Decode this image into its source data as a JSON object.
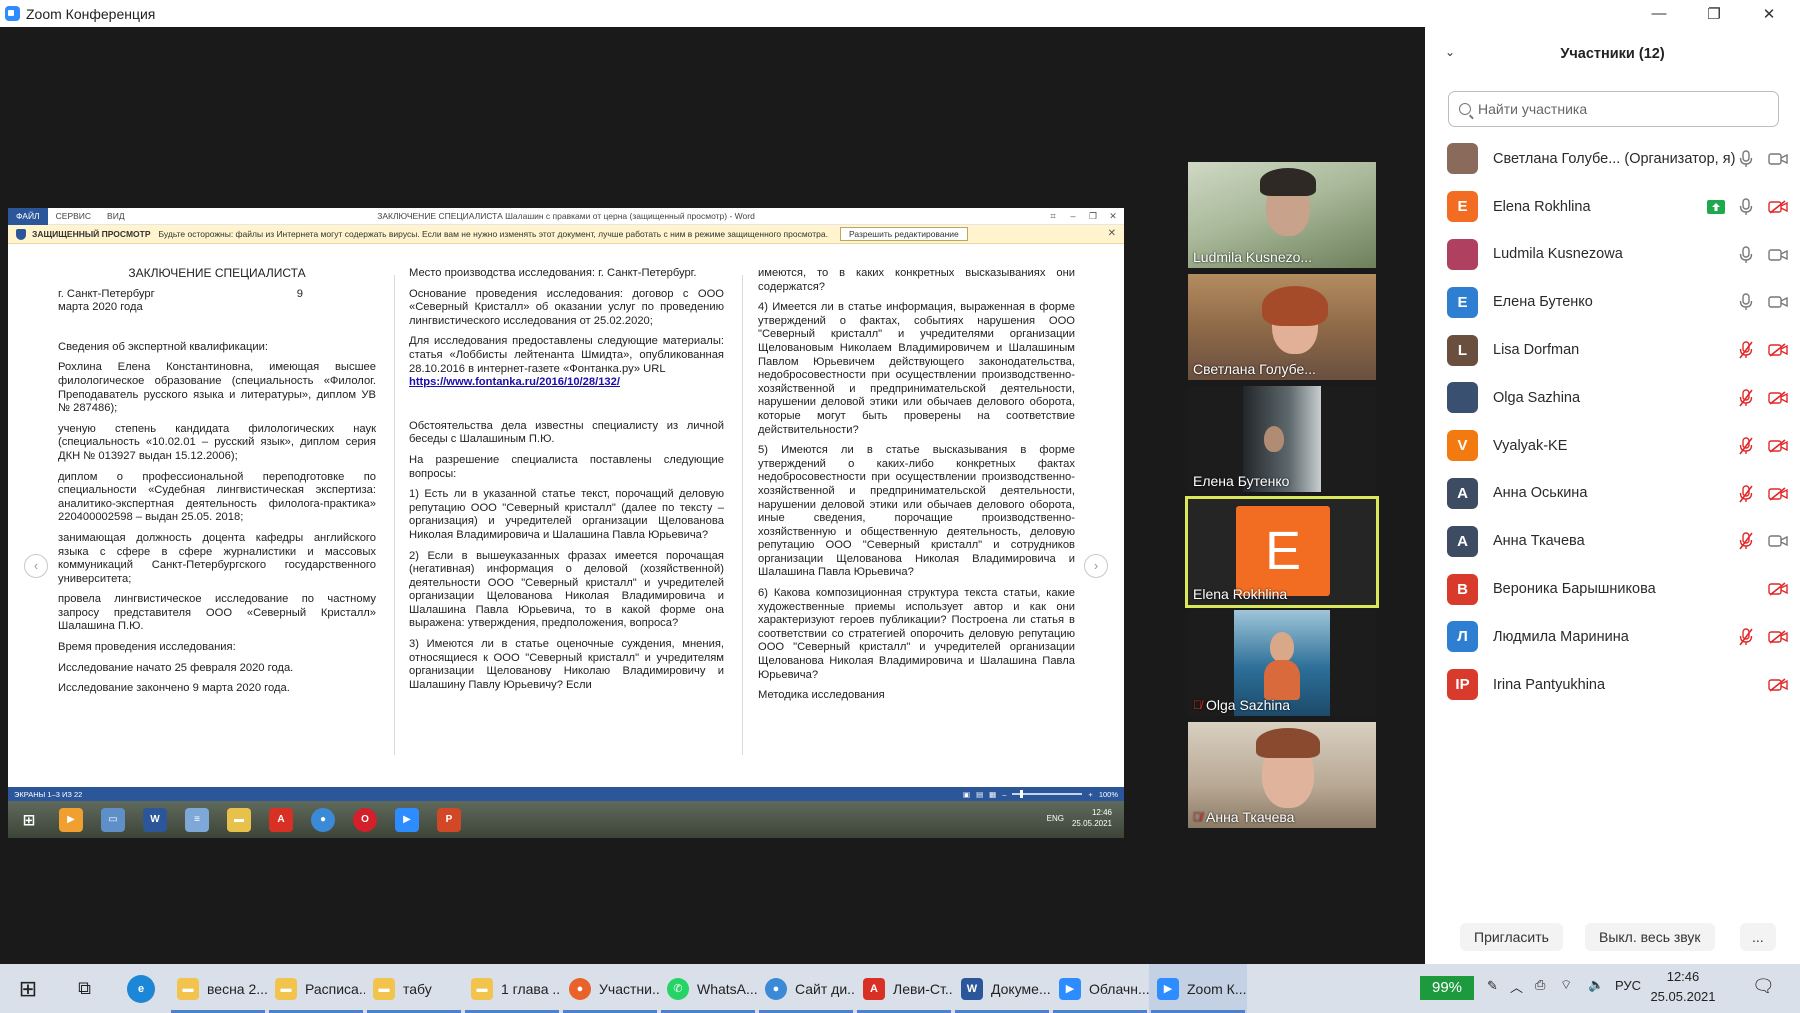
{
  "window": {
    "title": "Zoom Конференция",
    "min": "—",
    "max": "❐",
    "close": "✕"
  },
  "word": {
    "menu": [
      "ФАЙЛ",
      "СЕРВИС",
      "ВИД"
    ],
    "title": "ЗАКЛЮЧЕНИЕ СПЕЦИАЛИСТА Шалашин с правками от церна (защищенный просмотр) - Word",
    "protected_title": "ЗАЩИЩЕННЫЙ ПРОСМОТР",
    "protected_text": "Будьте осторожны: файлы из Интернета могут содержать вирусы. Если вам не нужно изменять этот документ, лучше работать с ним в режиме защищенного просмотра.",
    "enable_button": "Разрешить редактирование",
    "status_left": "ЭКРАНЫ 1–3 ИЗ 22",
    "zoom": "100%",
    "tray_lang": "ENG",
    "tray_time": "12:46",
    "tray_date": "25.05.2021"
  },
  "document": {
    "heading": "ЗАКЛЮЧЕНИЕ СПЕЦИАЛИСТА",
    "city": "г. Санкт-Петербург",
    "date_num": "9",
    "date_rest": "марта 2020 года",
    "col1": [
      "Сведения об экспертной квалификации:",
      "Рохлина Елена Константиновна, имеющая высшее филологическое образование (специальность «Филолог. Преподаватель русского языка и литературы», диплом УВ № 287486);",
      "ученую степень кандидата филологических наук (специальность «10.02.01 – русский язык», диплом серия ДКН № 013927 выдан 15.12.2006);",
      "диплом о профессиональной переподготовке по специальности «Судебная лингвистическая экспертиза: аналитико-экспертная деятельность филолога-практика» 220400002598 – выдан 25.05. 2018;",
      "занимающая должность доцента кафедры английского языка с сфере в сфере журналистики и массовых коммуникаций Санкт-Петербургского государственного университета;",
      "провелa лингвистическое исследование по частному запросу представителя ООО «Северный Кристалл» Шалашина П.Ю.",
      "Время проведения исследования:",
      "Исследование начато 25 февраля 2020 года.",
      "Исследование закончено 9 марта 2020 года."
    ],
    "col2_a": [
      "Место производства исследования: г. Санкт-Петербург.",
      "Основание проведения исследования: договор с ООО «Северный Кристалл» об оказании услуг по проведению лингвистического исследования от 25.02.2020;",
      "Для исследования предоставлены следующие материалы: статья «Лоббисты лейтенанта Шмидта», опубликованная 28.10.2016 в интернет-газете «Фонтанка.ру» URL"
    ],
    "link": "https://www.fontanka.ru/2016/10/28/132/",
    "col2_b": [
      "Обстоятельства дела известны специалисту из личной беседы с Шалашиным П.Ю.",
      "На разрешение специалиста поставлены следующие вопросы:",
      "1) Есть ли в указанной статье текст, порочащий деловую репутацию ООО \"Северный кристалл\" (далее по тексту – организация) и учредителей организации Щеловановa Николая Владимировича и Шалашина Павла Юрьевича?",
      "2) Если в вышеуказанных фразах имеется порочащая (негативная) информация о деловой (хозяйственной) деятельности ООО \"Северный кристалл\" и учредителей организации Щелованова Николая Владимировича и Шалашина Павла Юрьевича, то в какой форме она выражена: утверждения, предположения, вопроса?",
      "3) Имеются ли в статье оценочные суждения, мнения, относящиеся к ООО \"Северный кристалл\" и учредителям организации Щелованову Николаю Владимировичу и Шалашину Павлу Юрьевичу? Если"
    ],
    "col3": [
      "имеются, то в каких конкретных высказываниях они содержатся?",
      "4) Имеется ли в статье информация, выраженная в форме утверждений о фактах, событиях нарушения ООО \"Северный кристалл\" и учредителями организации Щеловановым Николаем Владимировичем и Шалашиным Павлом Юрьевичем действующего законодательства, недобросовестности при осуществлении производственно-хозяйственной и предпринимательской деятельности, нарушении деловой этики или обычаев делового оборота, которые могут быть проверены на соответствие действительности?",
      "5) Имеются ли в статье высказывания в форме утверждений о каких-либо конкретных фактах недобросовестности при осуществлении производственно-хозяйственной и предпринимательской деятельности, нарушении деловой этики или обычаев делового оборота, иные сведения, порочащие производственно-хозяйственную и общественную деятельность, деловую репутацию ООО \"Северный кристалл\" и сотрудников организации Щелованова Николая Владимировича и Шалашина Павла Юрьевича?",
      "6) Какова композиционная структура текста статьи, какие художественные приемы использует автор и как они характеризуют героев публикации? Построена ли статья в соответствии со стратегией опорочить деловую репутацию ООО \"Северный кристалл\" и учредителей организации Щелованова Николая Владимировича и Шалашина Павла Юрьевича?",
      "Методика исследования"
    ]
  },
  "thumbnails": [
    {
      "name": "Ludmila Kusnezo...",
      "muted": false
    },
    {
      "name": "Светлана Голубе...",
      "muted": false
    },
    {
      "name": "Елена Бутенко",
      "muted": false
    },
    {
      "name": "Elena Rokhlina",
      "muted": false,
      "initial": "E"
    },
    {
      "name": "Olga Sazhina",
      "muted": true
    },
    {
      "name": "Анна Ткачева",
      "muted": true
    }
  ],
  "participants_panel": {
    "title": "Участники (12)",
    "search_placeholder": "Найти участника",
    "invite": "Пригласить",
    "mute_all": "Выкл. весь звук",
    "more": "..."
  },
  "participants": [
    {
      "name": "Светлана Голубе... (Организатор, я)",
      "initial": "",
      "color": "#8a6a5a",
      "mic": "on",
      "cam": "on",
      "share": false
    },
    {
      "name": "Elena Rokhlina",
      "initial": "E",
      "color": "#f26d21",
      "mic": "on",
      "cam": "off",
      "share": true
    },
    {
      "name": "Ludmila Kusnezowa",
      "initial": "",
      "color": "#b04060",
      "mic": "on",
      "cam": "on",
      "share": false
    },
    {
      "name": "Елена Бутенко",
      "initial": "Е",
      "color": "#2e7fd2",
      "mic": "on",
      "cam": "on",
      "share": false
    },
    {
      "name": "Lisa Dorfman",
      "initial": "L",
      "color": "#6b4f3e",
      "mic": "off",
      "cam": "off",
      "share": false
    },
    {
      "name": "Olga Sazhina",
      "initial": "",
      "color": "#3a5070",
      "mic": "off",
      "cam": "off",
      "share": false
    },
    {
      "name": "Vyalyak-KE",
      "initial": "V",
      "color": "#f27a10",
      "mic": "off",
      "cam": "off",
      "share": false
    },
    {
      "name": "Анна Оськина",
      "initial": "А",
      "color": "#3d4b63",
      "mic": "off",
      "cam": "off",
      "share": false
    },
    {
      "name": "Анна Ткачева",
      "initial": "А",
      "color": "#3d4b63",
      "mic": "off",
      "cam": "on",
      "share": false
    },
    {
      "name": "Вероника Барышникова",
      "initial": "В",
      "color": "#d83b2b",
      "mic": "none",
      "cam": "off",
      "share": false
    },
    {
      "name": "Людмила Маринина",
      "initial": "Л",
      "color": "#2e7fd2",
      "mic": "off",
      "cam": "off",
      "share": false
    },
    {
      "name": "Irina Pantyukhina",
      "initial": "IP",
      "color": "#d83b2b",
      "mic": "none",
      "cam": "off",
      "share": false
    }
  ],
  "taskbar": {
    "items": [
      {
        "label": "весна 2...",
        "icon": "folder-icon",
        "color": "#f2c44e"
      },
      {
        "label": "Расписа...",
        "icon": "folder-icon",
        "color": "#f2c44e"
      },
      {
        "label": "табу",
        "icon": "folder-icon",
        "color": "#f2c44e"
      },
      {
        "label": "1 глава ...",
        "icon": "folder-icon",
        "color": "#f2c44e"
      },
      {
        "label": "Участни...",
        "icon": "firefox-icon",
        "color": "#e8622a"
      },
      {
        "label": "WhatsA...",
        "icon": "whatsapp-icon",
        "color": "#25d366"
      },
      {
        "label": "Сайт ди...",
        "icon": "chrome-icon",
        "color": "#3b8ad8"
      },
      {
        "label": "Леви-Ст...",
        "icon": "pdf-icon",
        "color": "#d93025"
      },
      {
        "label": "Докуме...",
        "icon": "word-icon",
        "color": "#2b579a"
      },
      {
        "label": "Облачн...",
        "icon": "zoom-icon",
        "color": "#2d8cff"
      },
      {
        "label": "Zoom К...",
        "icon": "zoom-icon",
        "color": "#2d8cff"
      }
    ],
    "battery": "99%",
    "lang": "РУС",
    "time": "12:46",
    "date": "25.05.2021"
  }
}
